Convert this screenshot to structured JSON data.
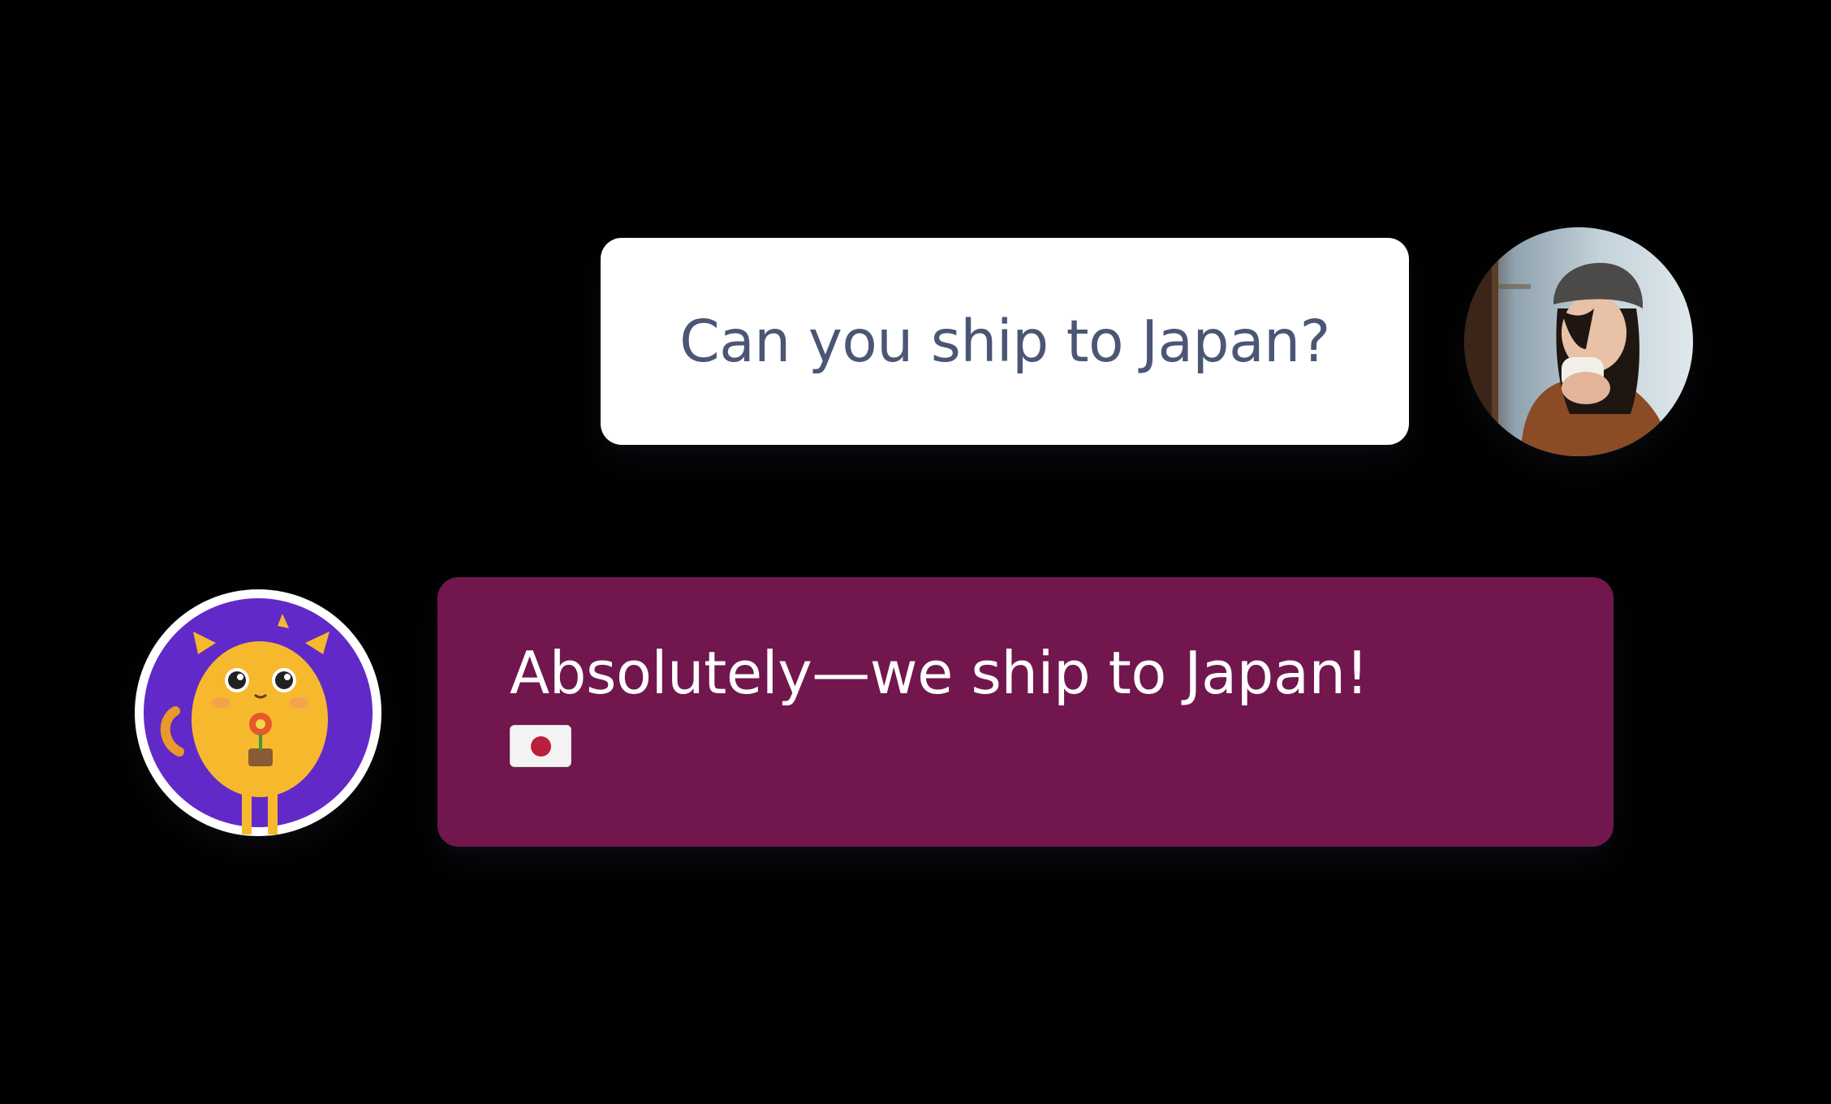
{
  "conversation": {
    "messages": [
      {
        "sender": "user",
        "text": "Can you ship to Japan?",
        "avatar_icon": "woman-drinking-coffee-photo"
      },
      {
        "sender": "bot",
        "text": "Absolutely—we ship to Japan!",
        "emoji_icon": "japan-flag-icon",
        "avatar_icon": "cat-mascot-icon"
      }
    ]
  },
  "colors": {
    "background": "#000000",
    "user_bubble": "#ffffff",
    "user_text": "#4a5674",
    "bot_bubble": "#72164e",
    "bot_text": "#ffffff",
    "bot_avatar_bg": "#6229c9",
    "cat_body": "#f6b92e",
    "flag_red": "#bc1f3d"
  }
}
